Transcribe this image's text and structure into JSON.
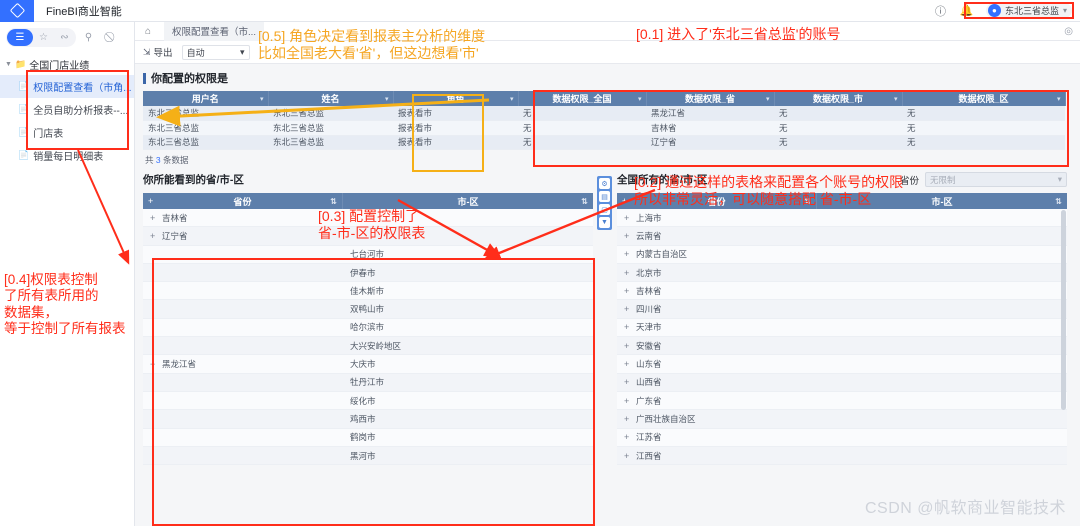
{
  "topbar": {
    "app_title": "FineBI商业智能",
    "logo_icon": "diamond-logo",
    "help_icon": "help-icon",
    "bell_icon": "bell-icon",
    "user_name": "东北三省总监",
    "avatar_icon": "user-avatar-icon",
    "caret_icon": "chevron-down-icon"
  },
  "sidebar": {
    "tools": [
      {
        "icon": "list-icon",
        "name": "directory-toggle"
      },
      {
        "icon": "star-icon",
        "name": "favorites"
      },
      {
        "icon": "share-icon",
        "name": "shared"
      },
      {
        "icon": "search-icon",
        "name": "search"
      },
      {
        "icon": "link-off-icon",
        "name": "unlink"
      }
    ],
    "root": {
      "label": "全国门店业绩",
      "folder_icon": "folder-icon",
      "twisty": "▾"
    },
    "items": [
      {
        "label": "权限配置查看（市角...",
        "selected": true
      },
      {
        "label": "全员自助分析报表--...",
        "selected": false
      },
      {
        "label": "门店表",
        "selected": false
      },
      {
        "label": "销量每日明细表",
        "selected": false
      }
    ]
  },
  "tabbar": {
    "home_icon": "home-icon",
    "tab_label": "权限配置查看（市...",
    "right_icon": "ellipsis-icon"
  },
  "toolbar": {
    "export_label": "导出",
    "export_icon": "export-icon",
    "layout_value": "自动",
    "layout_caret": "chevron-down-icon"
  },
  "perm_table": {
    "title": "你配置的权限是",
    "columns": [
      "用户名",
      "姓名",
      "角色",
      "数据权限_全国",
      "数据权限_省",
      "数据权限_市",
      "数据权限_区"
    ],
    "rows": [
      [
        "东北三省总监",
        "东北三省总监",
        "报表看市",
        "无",
        "黑龙江省",
        "无",
        "无"
      ],
      [
        "东北三省总监",
        "东北三省总监",
        "报表看市",
        "无",
        "吉林省",
        "无",
        "无"
      ],
      [
        "东北三省总监",
        "东北三省总监",
        "报表看市",
        "无",
        "辽宁省",
        "无",
        "无"
      ]
    ],
    "count_prefix": "共",
    "count_value": "3",
    "count_suffix": "条数据",
    "sort_icon": "sort-arrow-icon"
  },
  "left_tree": {
    "title": "你所能看到的省/市-区",
    "columns": [
      "省份",
      "市-区"
    ],
    "expand_icon": "plus-icon",
    "collapse_icon": "minus-icon",
    "sort_icon": "sort-icon",
    "rows": [
      {
        "province": "吉林省",
        "expanded": false,
        "city": ""
      },
      {
        "province": "辽宁省",
        "expanded": false,
        "city": ""
      },
      {
        "province": "",
        "expanded": null,
        "city": "七台河市"
      },
      {
        "province": "",
        "expanded": null,
        "city": "伊春市"
      },
      {
        "province": "",
        "expanded": null,
        "city": "佳木斯市"
      },
      {
        "province": "",
        "expanded": null,
        "city": "双鸭山市"
      },
      {
        "province": "",
        "expanded": null,
        "city": "哈尔滨市"
      },
      {
        "province": "",
        "expanded": null,
        "city": "大兴安岭地区"
      },
      {
        "province": "黑龙江省",
        "expanded": true,
        "city": "大庆市"
      },
      {
        "province": "",
        "expanded": null,
        "city": "牡丹江市"
      },
      {
        "province": "",
        "expanded": null,
        "city": "绥化市"
      },
      {
        "province": "",
        "expanded": null,
        "city": "鸡西市"
      },
      {
        "province": "",
        "expanded": null,
        "city": "鹤岗市"
      },
      {
        "province": "",
        "expanded": null,
        "city": "黑河市"
      }
    ]
  },
  "right_tree": {
    "title": "全国所有的省/市-区",
    "filter_label": "省份",
    "filter_value": "无限制",
    "filter_caret": "chevron-down-icon",
    "columns": [
      "省份",
      "市-区"
    ],
    "expand_icon": "plus-icon",
    "sort_icon": "sort-icon",
    "rows": [
      "上海市",
      "云南省",
      "内蒙古自治区",
      "北京市",
      "吉林省",
      "四川省",
      "天津市",
      "安徽省",
      "山东省",
      "山西省",
      "广东省",
      "广西壮族自治区",
      "江苏省",
      "江西省"
    ]
  },
  "vtools": {
    "icons": [
      "settings-icon",
      "chart-icon",
      "comment-icon",
      "collapse-icon"
    ]
  },
  "annotations": [
    {
      "id": "a01",
      "color": "#ff2d1a",
      "text": "[0.1] 进入了'东北三省总监'的账号"
    },
    {
      "id": "a02",
      "color": "#ff2d1a",
      "text": "[0.2] 通过这样的表格来配置各个账号的权限\n所以非常灵活，可以随意搭配 省-市-区"
    },
    {
      "id": "a03",
      "color": "#ff2d1a",
      "text": "[0.3] 配置控制了\n省-市-区的权限表"
    },
    {
      "id": "a04",
      "color": "#ff2d1a",
      "text": "[0.4]权限表控制\n了所有表所用的\n数据集，\n等于控制了所有报表"
    },
    {
      "id": "a05",
      "color": "#f5a623",
      "text": "[0.5] 角色决定看到报表主分析的维度\n比如全国老大看'省'，但这边想看'市'"
    }
  ],
  "watermark": "CSDN @帆软商业智能技术"
}
